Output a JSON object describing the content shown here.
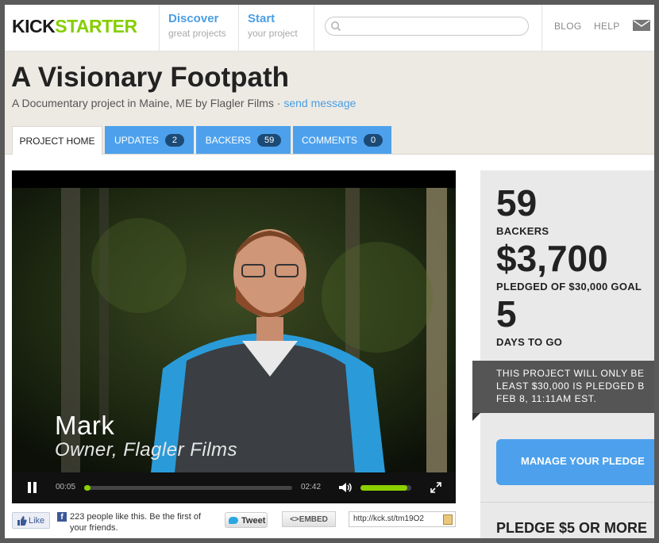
{
  "header": {
    "logo_part1": "KICK",
    "logo_part2": "STARTER",
    "nav": [
      {
        "title": "Discover",
        "subtitle": "great projects"
      },
      {
        "title": "Start",
        "subtitle": "your project"
      }
    ],
    "search_placeholder": "",
    "blog": "BLOG",
    "help": "HELP"
  },
  "project": {
    "title": "A Visionary Footpath",
    "subtitle_prefix": "A Documentary project in Maine, ME by Flagler Films · ",
    "send_message": "send message"
  },
  "tabs": [
    {
      "label": "PROJECT HOME",
      "count": null
    },
    {
      "label": "UPDATES",
      "count": "2"
    },
    {
      "label": "BACKERS",
      "count": "59"
    },
    {
      "label": "COMMENTS",
      "count": "0"
    }
  ],
  "video": {
    "caption_name": "Mark",
    "caption_role": "Owner, Flagler Films",
    "current_time": "00:05",
    "duration": "02:42",
    "progress_fraction": 0.03,
    "volume_fraction": 0.92
  },
  "share": {
    "like_label": "Like",
    "like_text": "223 people like this. Be the first of your friends.",
    "tweet_label": "Tweet",
    "embed_label": "<>EMBED",
    "short_url": "http://kck.st/tm19O2"
  },
  "stats": {
    "backers": "59",
    "backers_label": "BACKERS",
    "pledged": "$3,700",
    "pledged_label": "PLEDGED OF $30,000 GOAL",
    "days": "5",
    "days_label": "DAYS TO GO",
    "notice_line1": "THIS PROJECT WILL ONLY BE",
    "notice_line2": "LEAST $30,000 IS PLEDGED B",
    "notice_line3": "FEB 8, 11:11AM EST.",
    "manage_pledge": "MANAGE YOUR PLEDGE",
    "pledge_tier": "PLEDGE $5 OR MORE"
  },
  "colors": {
    "accent_blue": "#4da1ec",
    "kickstarter_green": "#86ce00",
    "band_bg": "#edeae3"
  }
}
